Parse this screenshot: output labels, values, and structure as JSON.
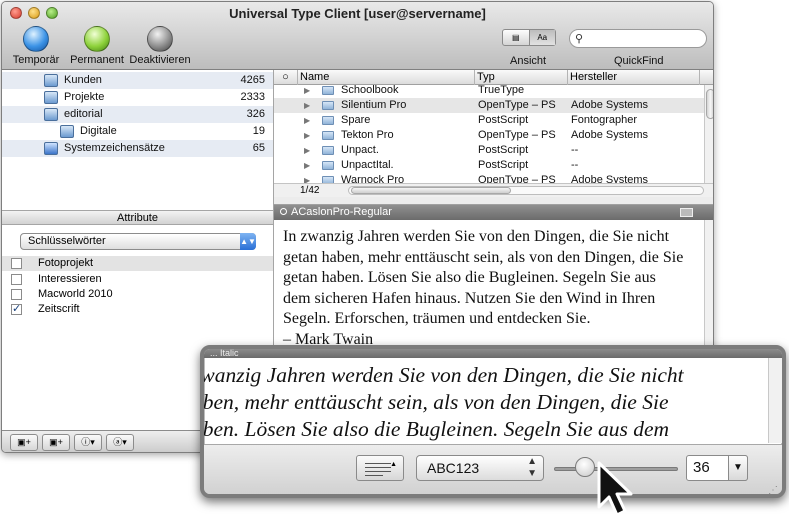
{
  "window": {
    "title": "Universal Type Client [user@servername]"
  },
  "toolbar": {
    "buttons": [
      {
        "label": "Temporär",
        "color": "#3c93e6"
      },
      {
        "label": "Permanent",
        "color": "#8ed23b"
      },
      {
        "label": "Deaktivieren",
        "color": "#8f8f8f"
      }
    ],
    "view_label": "Ansicht",
    "view_modes": [
      "list",
      "Aa"
    ],
    "quickfind_label": "QuickFind",
    "search_value": ""
  },
  "sidebar": {
    "sets": [
      {
        "label": "Kunden",
        "count": "4265",
        "icon": "font-set-icon"
      },
      {
        "label": "Projekte",
        "count": "2333",
        "icon": "font-set-icon"
      },
      {
        "label": "editorial",
        "count": "326",
        "icon": "font-set-icon"
      },
      {
        "label": "Digitale",
        "count": "19",
        "icon": "font-set-icon"
      },
      {
        "label": "Systemzeichensätze",
        "count": "65",
        "icon": "computer-icon"
      }
    ]
  },
  "attributes": {
    "header": "Attribute",
    "selected": "Schlüsselwörter",
    "keywords": [
      {
        "label": "Fotoprojekt",
        "checked": false
      },
      {
        "label": "Interessieren",
        "checked": false
      },
      {
        "label": "Macworld 2010",
        "checked": false
      },
      {
        "label": "Zeitscrift",
        "checked": true
      }
    ]
  },
  "fontlist": {
    "columns": [
      "Name",
      "Typ",
      "Hersteller"
    ],
    "rows": [
      {
        "name": "Schoolbook",
        "type": "TrueType",
        "maker": ""
      },
      {
        "name": "Silentium Pro",
        "type": "OpenType – PS",
        "maker": "Adobe Systems"
      },
      {
        "name": "Spare",
        "type": "PostScript",
        "maker": "Fontographer"
      },
      {
        "name": "Tekton Pro",
        "type": "OpenType – PS",
        "maker": "Adobe Systems"
      },
      {
        "name": "Unpact.",
        "type": "PostScript",
        "maker": "--"
      },
      {
        "name": "UnpactItal.",
        "type": "PostScript",
        "maker": "--"
      },
      {
        "name": "Warnock Pro",
        "type": "OpenType – PS",
        "maker": "Adobe Systems"
      }
    ],
    "selected_index": 1,
    "status": "1/42"
  },
  "preview": {
    "font_name": "ACaslonPro-Regular",
    "lines": [
      "In zwanzig Jahren werden Sie von den Dingen, die Sie nicht",
      "getan haben, mehr enttäuscht sein, als von den Dingen, die Sie",
      "getan haben. Lösen Sie also die Bugleinen. Segeln Sie aus",
      "dem sicheren Hafen hinaus. Nutzen Sie den Wind in Ihren",
      "Segeln. Erforschen, träumen und entdecken Sie.",
      "– Mark Twain"
    ]
  },
  "zoom": {
    "header": "... Italic",
    "lines": [
      "zwanzig Jahren werden Sie von den Dingen, die Sie nicht",
      "aben, mehr enttäuscht sein, als von den Dingen, die Sie",
      "aben. Lösen Sie also die Bugleinen. Segeln Sie aus dem"
    ],
    "sample_select": "ABC123",
    "size_value": "36",
    "slider_level": 0.25
  },
  "colors": {
    "accent": "#2a6fd6",
    "selection": "#e6e6e6"
  }
}
